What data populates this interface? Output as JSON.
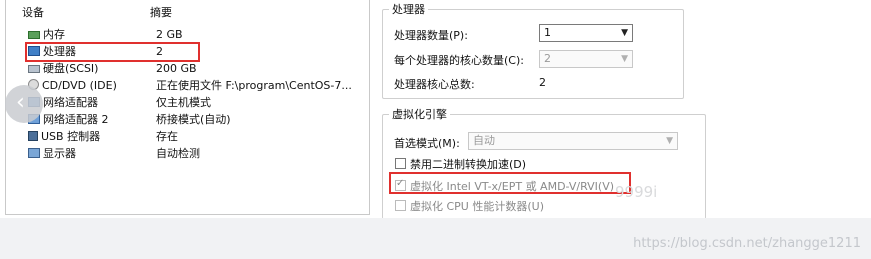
{
  "devices": {
    "header": {
      "device": "设备",
      "summary": "摘要"
    },
    "rows": [
      {
        "name": "内存",
        "summary": "2 GB",
        "icon": "memory-icon"
      },
      {
        "name": "处理器",
        "summary": "2",
        "icon": "processor-icon"
      },
      {
        "name": "硬盘(SCSI)",
        "summary": "200 GB",
        "icon": "hard-disk-icon"
      },
      {
        "name": "CD/DVD (IDE)",
        "summary": "正在使用文件 F:\\program\\CentOS-7...",
        "icon": "cd-dvd-icon"
      },
      {
        "name": "网络适配器",
        "summary": "仅主机模式",
        "icon": "network-adapter-icon"
      },
      {
        "name": "网络适配器 2",
        "summary": "桥接模式(自动)",
        "icon": "network-adapter-icon"
      },
      {
        "name": "USB 控制器",
        "summary": "存在",
        "icon": "usb-controller-icon"
      },
      {
        "name": "显示器",
        "summary": "自动检测",
        "icon": "display-icon"
      }
    ]
  },
  "processors": {
    "title": "处理器",
    "count_label": "处理器数量(P):",
    "count_value": "1",
    "cores_label": "每个处理器的核心数量(C):",
    "cores_value": "2",
    "total_label": "处理器核心总数:",
    "total_value": "2"
  },
  "virtualization": {
    "title": "虚拟化引擎",
    "mode_label": "首选模式(M):",
    "mode_value": "自动",
    "disable_binary_label": "禁用二进制转换加速(D)",
    "vtx_label": "虚拟化 Intel VT-x/EPT 或 AMD-V/RVI(V)",
    "cpu_counters_label": "虚拟化 CPU 性能计数器(U)"
  },
  "watermark": "https://blog.csdn.net/zhangge1211",
  "watermark_faint": "9999i",
  "colors": {
    "highlight_box": "#e0302e"
  }
}
